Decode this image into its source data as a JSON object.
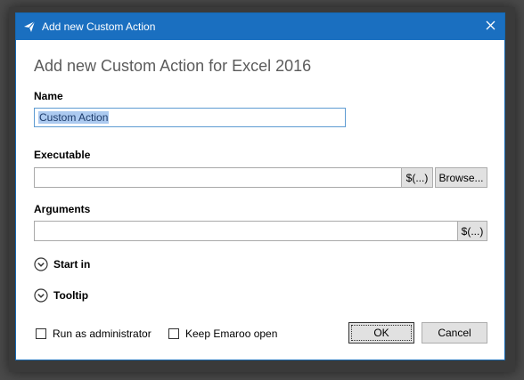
{
  "window": {
    "title": "Add new Custom Action",
    "icon": "paper-plane-icon",
    "close_icon": "close-icon"
  },
  "header": "Add new Custom Action for Excel 2016",
  "fields": {
    "name": {
      "label": "Name",
      "value": "Custom Action"
    },
    "executable": {
      "label": "Executable",
      "value": "",
      "var_button": "$(...)",
      "browse_button": "Browse..."
    },
    "arguments": {
      "label": "Arguments",
      "value": "",
      "var_button": "$(...)"
    }
  },
  "expanders": {
    "start_in": {
      "label": "Start in",
      "icon": "chevron-down-circle-icon"
    },
    "tooltip": {
      "label": "Tooltip",
      "icon": "chevron-down-circle-icon"
    }
  },
  "options": {
    "run_as_admin": {
      "label": "Run as administrator",
      "checked": false
    },
    "keep_open": {
      "label": "Keep Emaroo open",
      "checked": false
    }
  },
  "buttons": {
    "ok": "OK",
    "cancel": "Cancel"
  },
  "colors": {
    "titlebar": "#1a6fc0",
    "selection": "#accaf0",
    "focus_border": "#5e9bd2"
  }
}
